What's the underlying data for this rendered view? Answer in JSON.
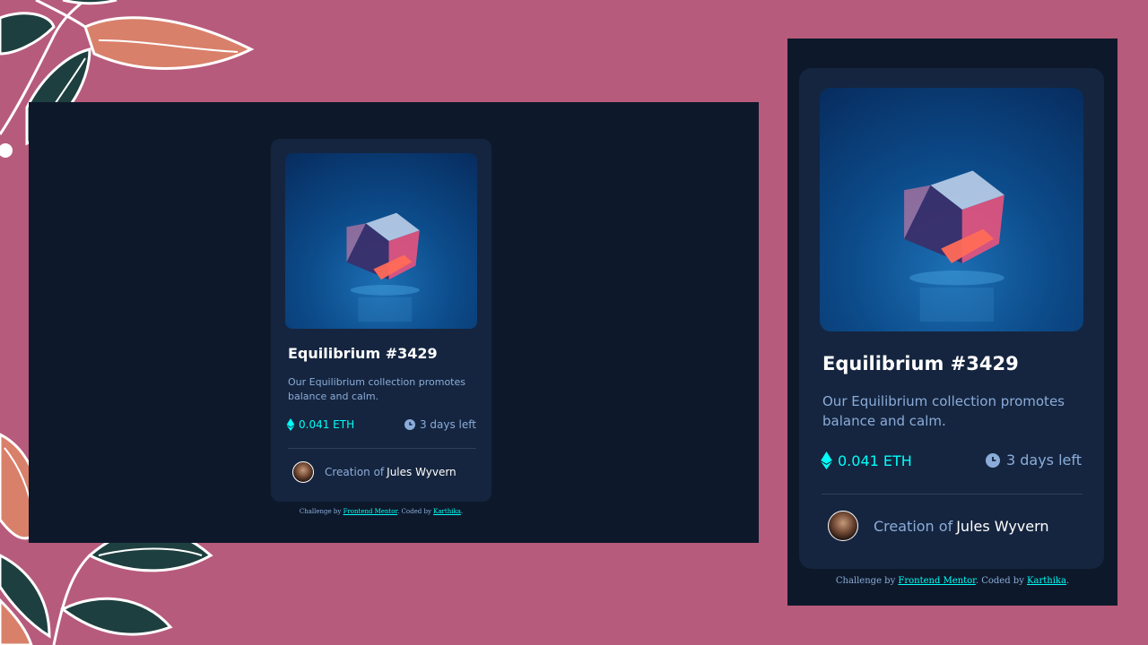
{
  "card": {
    "title": "Equilibrium #3429",
    "description": "Our Equilibrium collection promotes balance and calm.",
    "price": "0.041 ETH",
    "time_left": "3 days left",
    "creator_prefix": "Creation of",
    "creator_name": "Jules Wyvern",
    "icons": {
      "price": "ethereum-icon",
      "time": "clock-icon",
      "image": "cube-image",
      "avatar": "avatar-image"
    }
  },
  "attribution": {
    "prefix": "Challenge by",
    "link1": "Frontend Mentor",
    "middle": ". Coded by",
    "link2": "Karthika",
    "suffix": "."
  },
  "colors": {
    "page_background": "#b75b7c",
    "panel_background": "#0d192b",
    "card_background": "#15253f",
    "accent_cyan": "#00fff8",
    "soft_blue": "#8bacd9",
    "divider": "#2e405a",
    "white": "#ffffff"
  }
}
